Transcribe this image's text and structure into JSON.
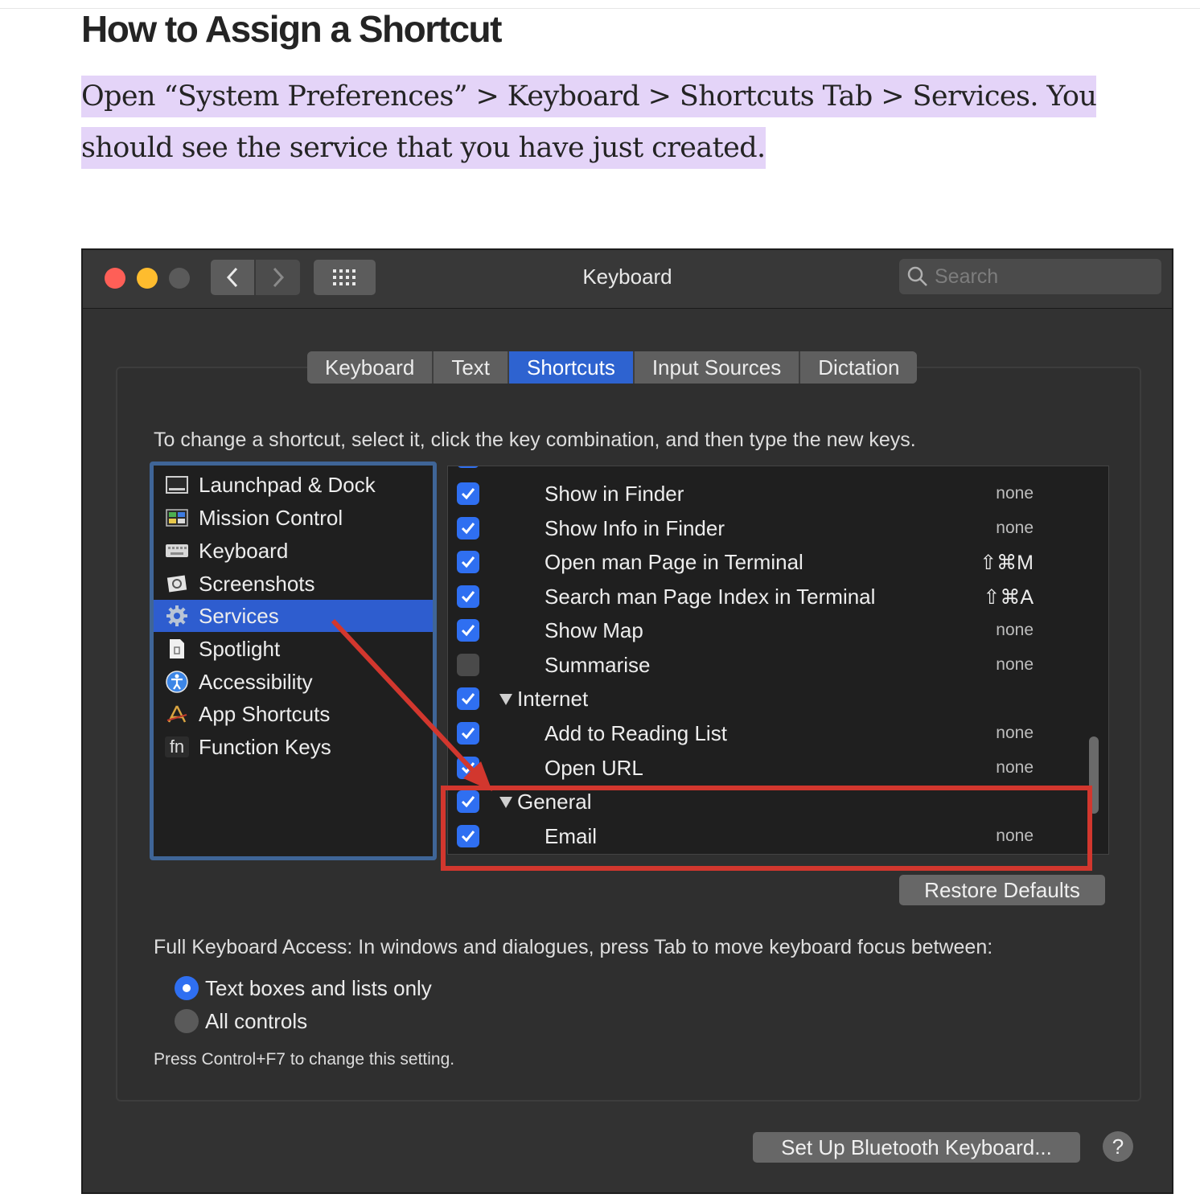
{
  "article": {
    "heading": "How to Assign a Shortcut",
    "paragraph_line1": "Open “System Preferences” > Keyboard > Shortcuts Tab > Services. You",
    "paragraph_line2": "should see the service that you have just created."
  },
  "window": {
    "title": "Keyboard",
    "search_placeholder": "Search",
    "tabs": [
      {
        "label": "Keyboard"
      },
      {
        "label": "Text"
      },
      {
        "label": "Shortcuts",
        "active": true
      },
      {
        "label": "Input Sources"
      },
      {
        "label": "Dictation"
      }
    ],
    "instructions": "To change a shortcut, select it, click the key combination, and then type the new keys.",
    "categories": [
      {
        "label": "Launchpad & Dock",
        "icon": "launchpad-dock-icon"
      },
      {
        "label": "Mission Control",
        "icon": "mission-control-icon"
      },
      {
        "label": "Keyboard",
        "icon": "keyboard-icon"
      },
      {
        "label": "Screenshots",
        "icon": "screenshots-icon"
      },
      {
        "label": "Services",
        "icon": "gear-icon",
        "selected": true
      },
      {
        "label": "Spotlight",
        "icon": "spotlight-icon"
      },
      {
        "label": "Accessibility",
        "icon": "accessibility-icon"
      },
      {
        "label": "App Shortcuts",
        "icon": "app-shortcuts-icon"
      },
      {
        "label": "Function Keys",
        "icon": "fn-icon",
        "icon_text": "fn"
      }
    ],
    "services": [
      {
        "label": "Show in Finder",
        "shortcut": "none",
        "checked": true
      },
      {
        "label": "Show Info in Finder",
        "shortcut": "none",
        "checked": true
      },
      {
        "label": "Open man Page in Terminal",
        "shortcut": "⇧⌘M",
        "checked": true
      },
      {
        "label": "Search man Page Index in Terminal",
        "shortcut": "⇧⌘A",
        "checked": true
      },
      {
        "label": "Show Map",
        "shortcut": "none",
        "checked": true
      },
      {
        "label": "Summarise",
        "shortcut": "none",
        "checked": false
      },
      {
        "label": "Internet",
        "group": true,
        "checked": true
      },
      {
        "label": "Add to Reading List",
        "shortcut": "none",
        "checked": true
      },
      {
        "label": "Open URL",
        "shortcut": "none",
        "checked": true
      },
      {
        "label": "General",
        "group": true,
        "checked": true
      },
      {
        "label": "Email",
        "shortcut": "none",
        "checked": true
      }
    ],
    "restore_defaults": "Restore Defaults",
    "full_keyboard_access": "Full Keyboard Access: In windows and dialogues, press Tab to move keyboard focus between:",
    "radio_options": [
      {
        "label": "Text boxes and lists only",
        "selected": true
      },
      {
        "label": "All controls",
        "selected": false
      }
    ],
    "hint": "Press Control+F7 to change this setting.",
    "bluetooth_button": "Set Up Bluetooth Keyboard...",
    "help_button": "?"
  },
  "annotation_color": "#d2372e",
  "accent_color": "#2e5dcf"
}
